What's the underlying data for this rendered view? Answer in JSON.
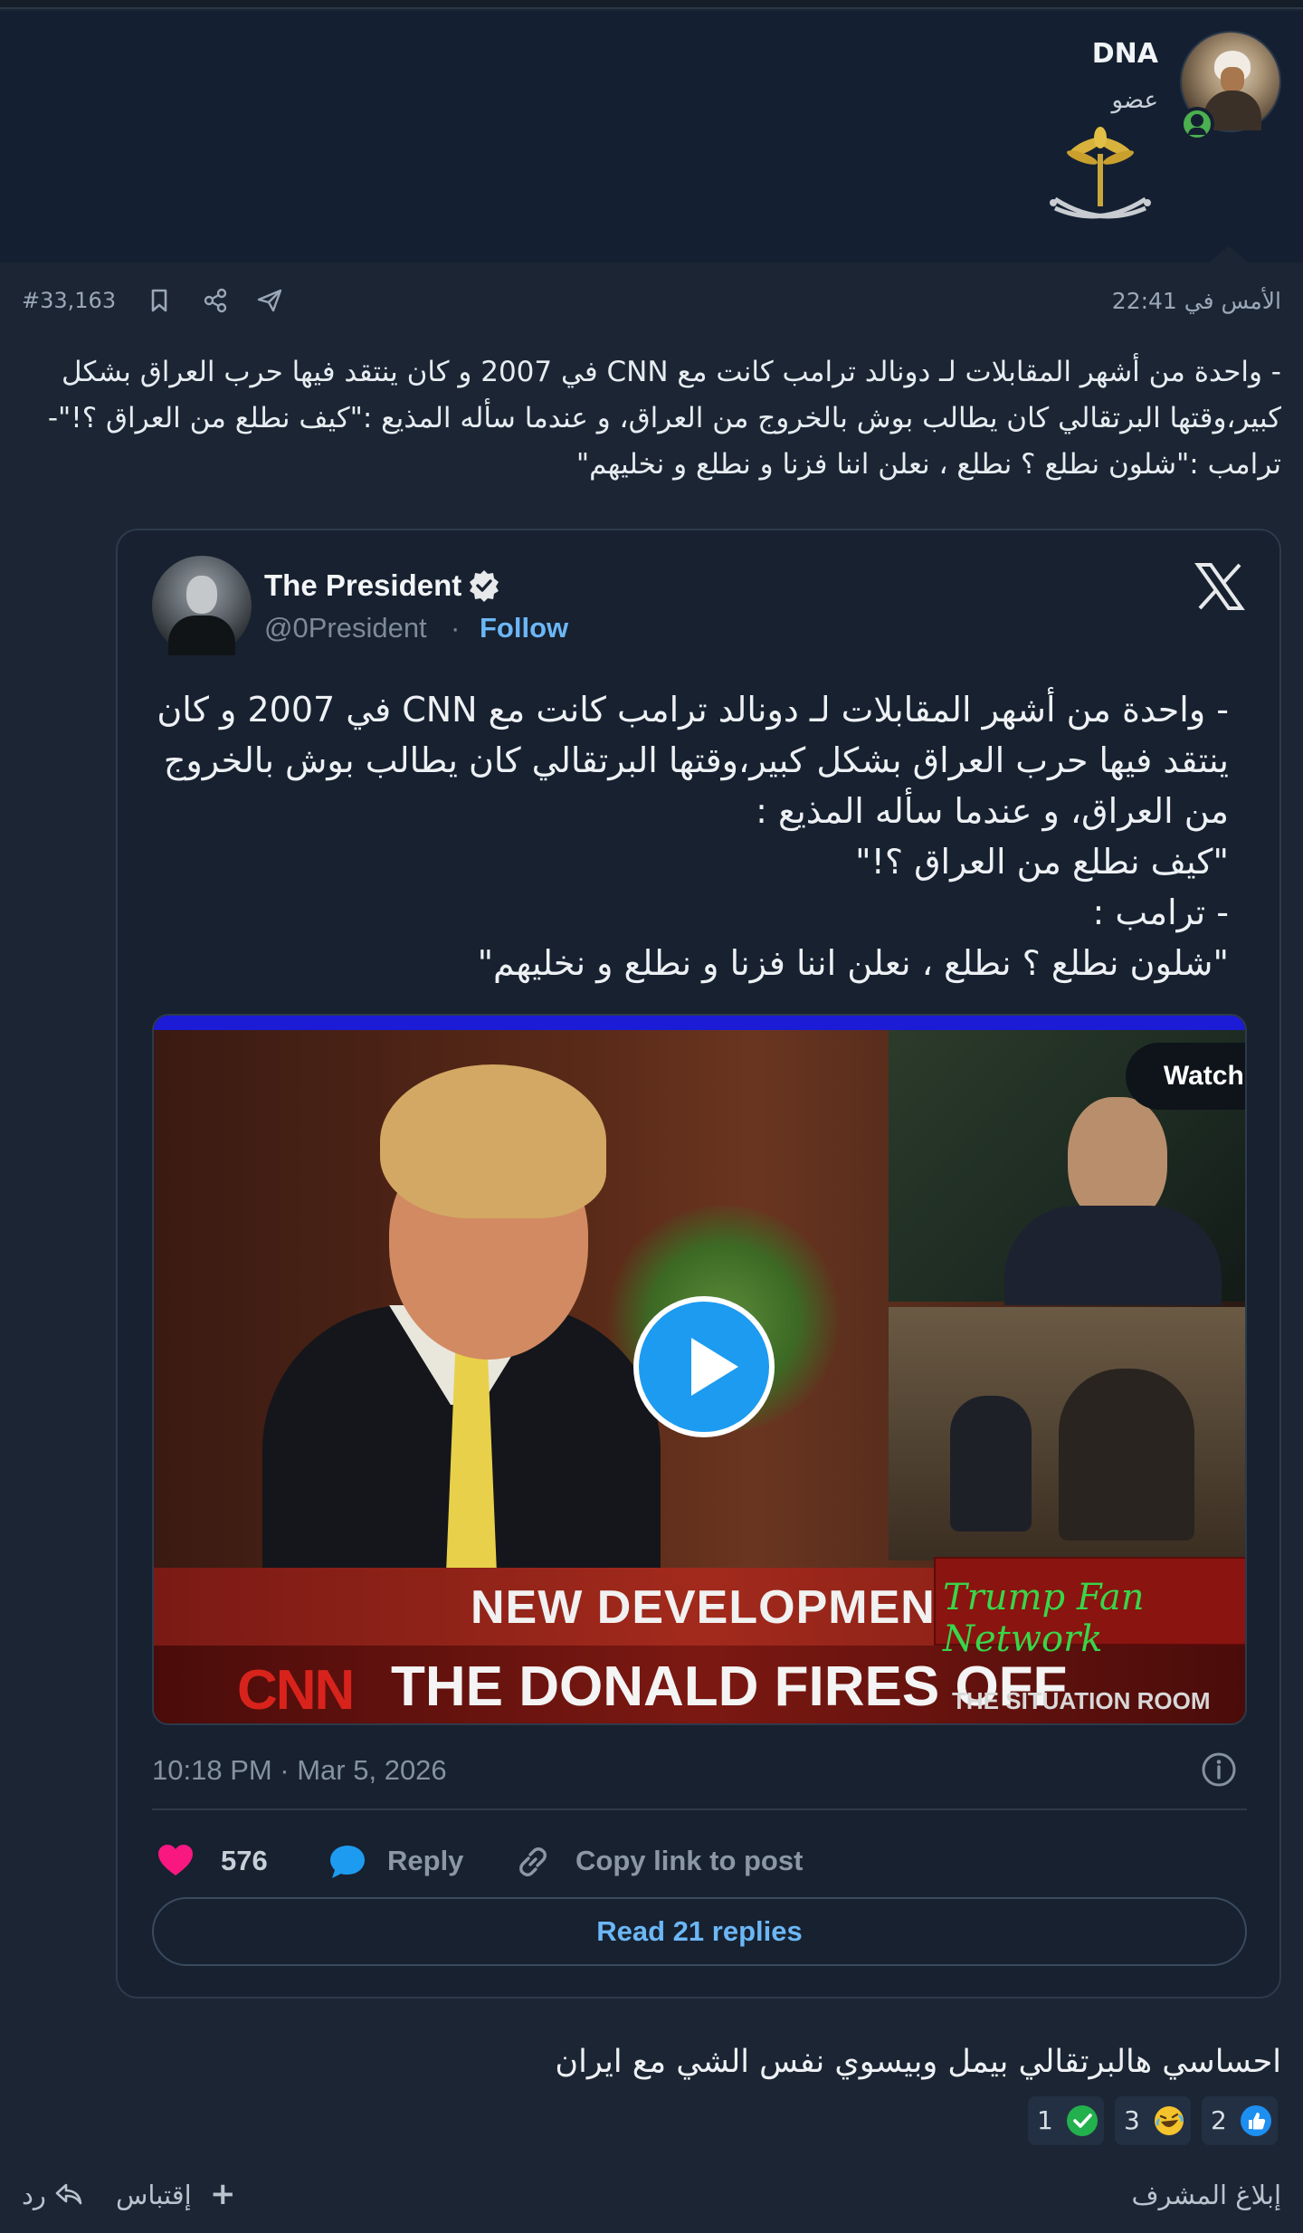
{
  "author": {
    "username": "DNA",
    "user_title": "عضو",
    "avatar_icon": "user-avatar",
    "emblem_icon": "saudi-emblem-icon",
    "online_status_icon": "online-status-icon"
  },
  "post_meta": {
    "timestamp": "الأمس في 22:41",
    "post_number": "#33,163",
    "icons": [
      "bookmark-icon",
      "share-icon",
      "send-icon"
    ]
  },
  "post_body": {
    "text": "- واحدة من أشهر المقابلات لـ دونالد ترامب كانت مع CNN في 2007 و كان ينتقد فيها حرب العراق بشكل كبير،وقتها البرتقالي كان يطالب بوش بالخروج من العراق، و عندما سأله المذيع :\"كيف نطلع من العراق ؟!\"- ترامب :\"شلون نطلع ؟ نطلع ، نعلن اننا فزنا و نطلع و نخليهم\""
  },
  "embed": {
    "name": "The President",
    "handle": "@0President",
    "separator": "·",
    "follow_label": "Follow",
    "text": "- واحدة من أشهر المقابلات لـ دونالد ترامب كانت مع CNN في 2007 و كان ينتقد فيها حرب العراق بشكل كبير،وقتها البرتقالي كان يطالب بوش بالخروج من العراق، و عندما سأله المذيع :\n\"كيف نطلع من العراق ؟!\"\n- ترامب :\n\"شلون نطلع ؟ نطلع ، نعلن اننا فزنا و نطلع و نخليهم\"",
    "video": {
      "watch_label": "Watch on X",
      "caption_line1": "NEW DEVELOPMENTS",
      "caption_network": "CNN",
      "caption_line2": "THE DONALD FIRES OFF",
      "caption_show": "THE SITUATION ROOM",
      "overlay_brand": "Trump Fan Network"
    },
    "date": "10:18 PM · Mar 5, 2026",
    "likes": "576",
    "reply_label": "Reply",
    "copy_label": "Copy link to post",
    "read_replies_label": "Read 21 replies",
    "colors": {
      "accent": "#1d9bf0",
      "link": "#6cb7f5",
      "like": "#f91880"
    }
  },
  "post_body_2": {
    "text": "احساسي هالبرتقالي بيمل وبيسوي نفس الشي مع ايران"
  },
  "reactions": [
    {
      "count": "2",
      "icon": "thumbs-up-icon",
      "color": "#1d8ff0"
    },
    {
      "count": "3",
      "icon": "laughing-emoji-icon",
      "color": "#f5c32c"
    },
    {
      "count": "1",
      "icon": "check-icon",
      "color": "#22b14c"
    }
  ],
  "footer": {
    "report_label": "إبلاغ المشرف",
    "quote_label": "إقتباس",
    "quote_plus": "+",
    "reply_label": "رد"
  },
  "colors": {
    "background": "#1b2533",
    "header_background": "#142031"
  }
}
